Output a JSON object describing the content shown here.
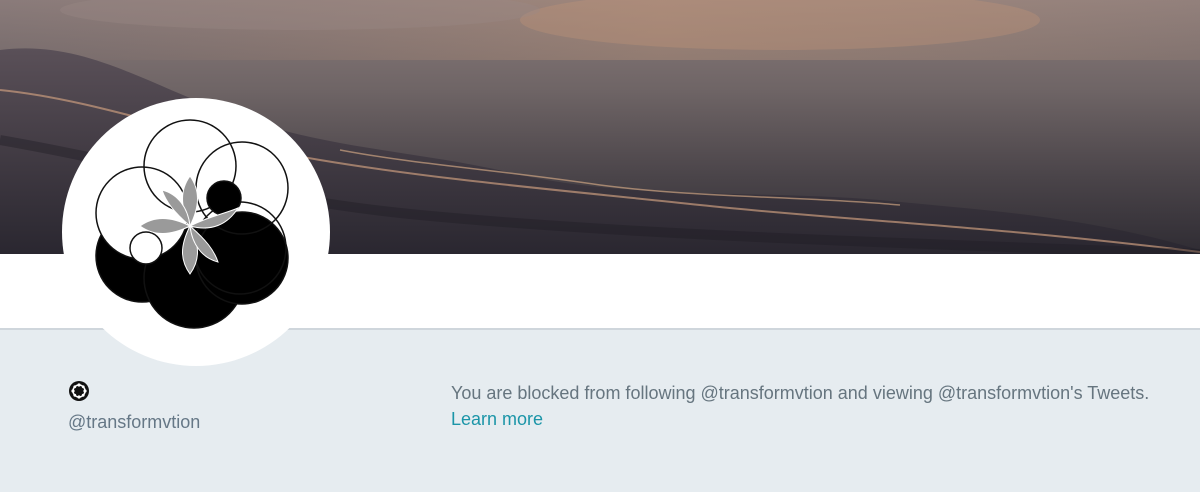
{
  "profile": {
    "handle": "@transformvtion"
  },
  "blocked_notice": {
    "message": "You are blocked from following @transformvtion and viewing @transformvtion's Tweets.",
    "link_label": "Learn more"
  },
  "icons": {
    "avatar": "sacred-geometry-logo-icon",
    "small": "flower-badge-icon"
  },
  "colors": {
    "page_background": "#e6ecf0",
    "link": "#1b95a8",
    "muted_text": "#66757f",
    "navbar": "#ffffff"
  }
}
